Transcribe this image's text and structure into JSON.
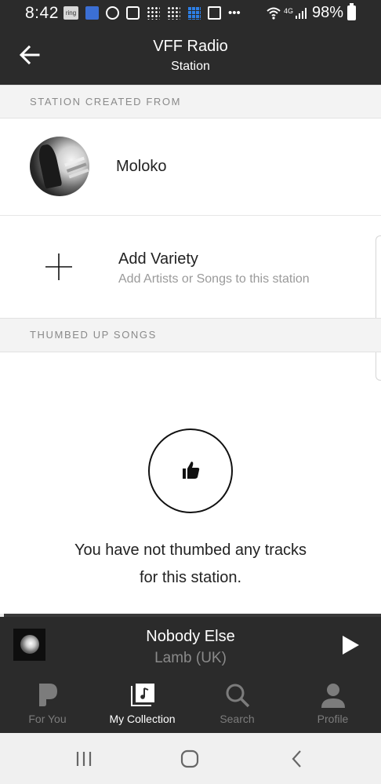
{
  "status_bar": {
    "time": "8:42",
    "notification_icons": [
      "ring-icon",
      "app-icon",
      "account-icon",
      "calendar-icon",
      "fitbit-icon",
      "fitbit-icon",
      "grid-app-icon",
      "image-icon",
      "more-icon"
    ],
    "network_label": "4G",
    "battery": "98%"
  },
  "header": {
    "title": "VFF Radio",
    "subtitle": "Station",
    "back_icon": "arrow-left-icon"
  },
  "sections": {
    "created_from": "STATION CREATED FROM",
    "thumbed_up": "THUMBED UP SONGS"
  },
  "seed": {
    "name": "Moloko"
  },
  "variety": {
    "title": "Add Variety",
    "subtitle": "Add Artists or Songs to this station",
    "icon": "plus-icon"
  },
  "empty_state": {
    "line1": "You have not thumbed any tracks",
    "line2": "for this station.",
    "icon": "thumbs-up-icon"
  },
  "now_playing": {
    "title": "Nobody Else",
    "artist": "Lamb (UK)",
    "progress": 0.01,
    "play_icon": "play-icon"
  },
  "bottom_nav": {
    "items": [
      {
        "label": "For You",
        "icon": "pandora-icon",
        "active": false
      },
      {
        "label": "My Collection",
        "icon": "collection-icon",
        "active": true
      },
      {
        "label": "Search",
        "icon": "search-icon",
        "active": false
      },
      {
        "label": "Profile",
        "icon": "profile-icon",
        "active": false
      }
    ]
  },
  "colors": {
    "header_bg": "#2b2b2b",
    "section_bg": "#f3f3f3",
    "active_nav": "#ffffff",
    "inactive_nav": "#7c7c7c"
  }
}
